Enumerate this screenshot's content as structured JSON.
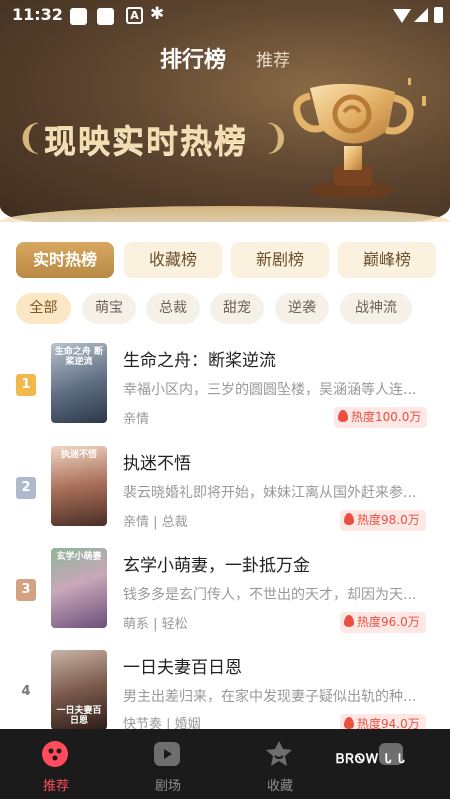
{
  "status_bar": {
    "time": "11:32"
  },
  "header": {
    "title": "排行榜",
    "subtitle": "推荐",
    "banner": "现映实时热榜"
  },
  "tabs": [
    "实时热榜",
    "收藏榜",
    "新剧榜",
    "巅峰榜"
  ],
  "chips": [
    "全部",
    "萌宝",
    "总裁",
    "甜宠",
    "逆袭",
    "战神流"
  ],
  "items": [
    {
      "rank": "1",
      "title": "生命之舟：断桨逆流",
      "desc": "幸福小区内，三岁的圆圆坠楼，吴涵涵等人连...",
      "tags": "亲情",
      "heat": "热度100.0万",
      "cover_text": "生命之舟 断桨逆流"
    },
    {
      "rank": "2",
      "title": "执迷不悟",
      "desc": "裴云晓婚礼即将开始，妹妹江离从国外赶来参...",
      "tags": "亲情 | 总裁",
      "heat": "热度98.0万",
      "cover_text": "执迷不悟"
    },
    {
      "rank": "3",
      "title": "玄学小萌妻，一卦抵万金",
      "desc": "钱多多是玄门传人，不世出的天才，却因为天...",
      "tags": "萌系 | 轻松",
      "heat": "热度96.0万",
      "cover_text": "玄学小萌妻"
    },
    {
      "rank": "4",
      "title": "一日夫妻百日恩",
      "desc": "男主出差归来，在家中发现妻子疑似出轨的种...",
      "tags": "快节奏 | 婚姻",
      "heat": "热度94.0万",
      "cover_text": "一日夫妻百日恩"
    }
  ],
  "bottom_nav": [
    {
      "label": "推荐",
      "icon": "recommend-icon",
      "active": true
    },
    {
      "label": "剧场",
      "icon": "theater-icon",
      "active": false
    },
    {
      "label": "收藏",
      "icon": "favorite-icon",
      "active": false
    },
    {
      "label": "",
      "icon": "profile-icon",
      "active": false
    }
  ],
  "watermark": "ᏴᏒᏫᎳ Ꮣ Ꮣ",
  "colors": {
    "accent": "#b98a45",
    "heat": "#ea5042",
    "active_nav": "#ff4b5c"
  }
}
